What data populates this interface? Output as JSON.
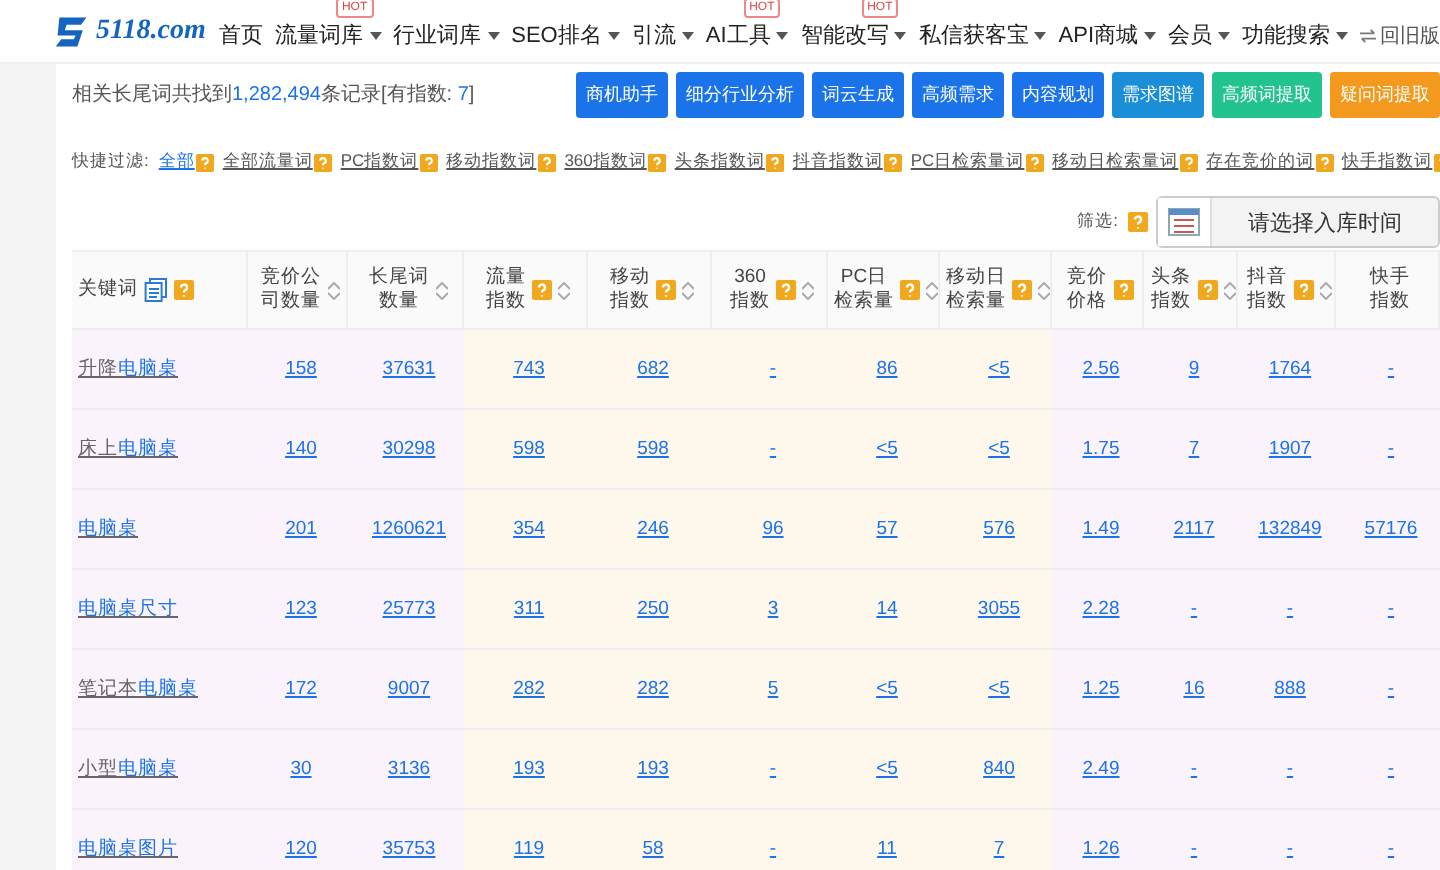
{
  "nav": {
    "logo": "5118.com",
    "items": [
      {
        "label": "首页",
        "dropdown": false
      },
      {
        "label": "流量词库",
        "dropdown": true,
        "hot_badge": "HOT"
      },
      {
        "label": "行业词库",
        "dropdown": true
      },
      {
        "label": "SEO排名",
        "dropdown": true
      },
      {
        "label": "引流",
        "dropdown": true
      },
      {
        "label": "AI工具",
        "dropdown": true,
        "hot_badge": "HOT"
      },
      {
        "label": "智能改写",
        "dropdown": true,
        "hot_badge": "HOT"
      },
      {
        "label": "私信获客宝",
        "dropdown": true
      },
      {
        "label": "API商城",
        "dropdown": true
      },
      {
        "label": "会员",
        "dropdown": true
      },
      {
        "label": "功能搜索",
        "dropdown": true
      }
    ],
    "old_version": "回旧版"
  },
  "summary": {
    "prefix": "相关长尾词共找到",
    "count": "1,282,494",
    "middle": "条记录[有指数:",
    "index_count": "7",
    "suffix": "]"
  },
  "actions": [
    {
      "label": "商机助手",
      "color": "#1a73e8"
    },
    {
      "label": "细分行业分析",
      "color": "#1a73e8"
    },
    {
      "label": "词云生成",
      "color": "#1a73e8"
    },
    {
      "label": "高频需求",
      "color": "#1a73e8"
    },
    {
      "label": "内容规划",
      "color": "#1a73e8"
    },
    {
      "label": "需求图谱",
      "color": "#1a8fd8"
    },
    {
      "label": "高频词提取",
      "color": "#22c38e"
    },
    {
      "label": "疑问词提取",
      "color": "#f39a1e"
    }
  ],
  "quick_filter": {
    "label": "快捷过滤:",
    "items": [
      {
        "label": "全部",
        "selected": true
      },
      {
        "label": "全部流量词",
        "selected": false
      },
      {
        "label": "PC指数词",
        "selected": false
      },
      {
        "label": "移动指数词",
        "selected": false
      },
      {
        "label": "360指数词",
        "selected": false
      },
      {
        "label": "头条指数词",
        "selected": false
      },
      {
        "label": "抖音指数词",
        "selected": false
      },
      {
        "label": "PC日检索量词",
        "selected": false
      },
      {
        "label": "移动日检索量词",
        "selected": false
      },
      {
        "label": "存在竞价的词",
        "selected": false
      },
      {
        "label": "快手指数词",
        "selected": false
      }
    ]
  },
  "screen": {
    "label": "筛选:",
    "date_placeholder": "请选择入库时间"
  },
  "table": {
    "keyword_header": {
      "label": "关键词",
      "help": true
    },
    "columns": [
      {
        "label": "竞价公司数量",
        "help": false,
        "sortable": true
      },
      {
        "label": "长尾词数量",
        "help": false,
        "sortable": true
      },
      {
        "label": "流量指数",
        "help": true,
        "sortable": true
      },
      {
        "label": "移动指数",
        "help": true,
        "sortable": true
      },
      {
        "label": "360指数",
        "help": true,
        "sortable": true
      },
      {
        "label": "PC日检索量",
        "help": true,
        "sortable": true
      },
      {
        "label": "移动日检索量",
        "help": true,
        "sortable": true
      },
      {
        "label": "竞价价格",
        "help": true,
        "sortable": false
      },
      {
        "label": "头条指数",
        "help": true,
        "sortable": true
      },
      {
        "label": "抖音指数",
        "help": true,
        "sortable": true
      },
      {
        "label": "快手指数",
        "help": false,
        "sortable": false
      }
    ],
    "rows": [
      {
        "keyword": [
          {
            "text": "升降",
            "match": false
          },
          {
            "text": "电脑桌",
            "match": true
          }
        ],
        "cells": [
          "158",
          "37631",
          "743",
          "682",
          "-",
          "86",
          "<5",
          "2.56",
          "9",
          "1764",
          "-"
        ]
      },
      {
        "keyword": [
          {
            "text": "床上",
            "match": false
          },
          {
            "text": "电脑桌",
            "match": true
          }
        ],
        "cells": [
          "140",
          "30298",
          "598",
          "598",
          "-",
          "<5",
          "<5",
          "1.75",
          "7",
          "1907",
          "-"
        ]
      },
      {
        "keyword": [
          {
            "text": "电脑桌",
            "match": true
          }
        ],
        "cells": [
          "201",
          "1260621",
          "354",
          "246",
          "96",
          "57",
          "576",
          "1.49",
          "2117",
          "132849",
          "57176"
        ]
      },
      {
        "keyword": [
          {
            "text": "电脑桌尺寸",
            "match": true
          }
        ],
        "cells": [
          "123",
          "25773",
          "311",
          "250",
          "3",
          "14",
          "3055",
          "2.28",
          "-",
          "-",
          "-"
        ]
      },
      {
        "keyword": [
          {
            "text": "笔记本",
            "match": false
          },
          {
            "text": "电脑桌",
            "match": true
          }
        ],
        "cells": [
          "172",
          "9007",
          "282",
          "282",
          "5",
          "<5",
          "<5",
          "1.25",
          "16",
          "888",
          "-"
        ]
      },
      {
        "keyword": [
          {
            "text": "小型",
            "match": false
          },
          {
            "text": "电脑桌",
            "match": true
          }
        ],
        "cells": [
          "30",
          "3136",
          "193",
          "193",
          "-",
          "<5",
          "840",
          "2.49",
          "-",
          "-",
          "-"
        ]
      },
      {
        "keyword": [
          {
            "text": "电脑桌图片",
            "match": true
          }
        ],
        "cells": [
          "120",
          "35753",
          "119",
          "58",
          "-",
          "11",
          "7",
          "1.26",
          "-",
          "-",
          "-"
        ]
      }
    ]
  }
}
